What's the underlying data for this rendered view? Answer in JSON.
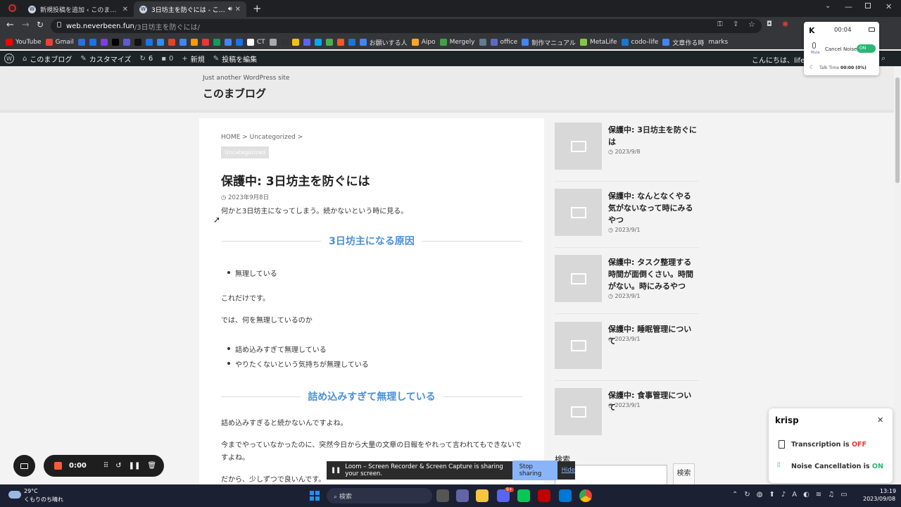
{
  "browser": {
    "tabs": [
      {
        "title": "新規投稿を追加 ‹ このまブログ — WordPress",
        "active": false
      },
      {
        "title": "3日坊主を防ぐには - このまブログ",
        "active": true
      }
    ],
    "new_tab_symbol": "+",
    "url_host": "web.neverbeen.fun",
    "url_path": "/3日坊主を防ぐには/"
  },
  "bookmarks": [
    {
      "label": "YouTube",
      "color": "#ff0000"
    },
    {
      "label": "Gmail",
      "color": "#ea4335"
    },
    {
      "label": "",
      "color": "#2a6fdb",
      "icon": "CW"
    },
    {
      "label": "",
      "color": "#1a73e8",
      "icon": "L"
    },
    {
      "label": "",
      "color": "#7b3fe4"
    },
    {
      "label": "",
      "color": "#000000"
    },
    {
      "label": "",
      "color": "#5b5bd6"
    },
    {
      "label": "",
      "color": "#111111"
    },
    {
      "label": "",
      "color": "#1a73e8"
    },
    {
      "label": "",
      "color": "#2d8cff"
    },
    {
      "label": "",
      "color": "#e24329"
    },
    {
      "label": "",
      "color": "#4285f4"
    },
    {
      "label": "",
      "color": "#ff9900"
    },
    {
      "label": "",
      "color": "#e53935"
    },
    {
      "label": "",
      "color": "#0f9d58"
    },
    {
      "label": "",
      "color": "#4285f4"
    },
    {
      "label": "",
      "color": "#1a73e8"
    },
    {
      "label": "CT",
      "color": "#ffffff"
    },
    {
      "label": "",
      "color": "#aaaaaa"
    },
    {
      "label": "",
      "color": "#333333"
    },
    {
      "label": "",
      "color": "#f4c20d"
    },
    {
      "label": "",
      "color": "#5865f2"
    },
    {
      "label": "",
      "color": "#03a9f4"
    },
    {
      "label": "",
      "color": "#4caf50"
    },
    {
      "label": "",
      "color": "#ff5722"
    },
    {
      "label": "",
      "color": "#1976d2"
    },
    {
      "label": "お願いする人",
      "color": "#4285f4"
    },
    {
      "label": "Aipo",
      "color": "#f9a825"
    },
    {
      "label": "Mergely",
      "color": "#43a047"
    },
    {
      "label": "",
      "color": "#607d8b"
    },
    {
      "label": "office",
      "color": "#5c6bc0"
    },
    {
      "label": "制作マニュアル",
      "color": "#4285f4"
    },
    {
      "label": "MetaLife",
      "color": "#8bc34a"
    },
    {
      "label": "codo-life",
      "color": "#1976d2"
    },
    {
      "label": "文章作る時",
      "color": "#4285f4"
    },
    {
      "label": "marks",
      "color": ""
    }
  ],
  "adminbar": {
    "wp_logo": "W",
    "site_name": "このまブログ",
    "customize": "カスタマイズ",
    "updates_count": "6",
    "comments_count": "0",
    "new": "新規",
    "edit_post": "投稿を編集",
    "greeting": "こんにちは、lifesa"
  },
  "site": {
    "tagline": "Just another WordPress site",
    "title": "このまブログ"
  },
  "article": {
    "breadcrumb": [
      "HOME",
      ">",
      "Uncategorized",
      ">"
    ],
    "category": "Uncategorized",
    "title": "保護中: 3日坊主を防ぐには",
    "date": "2023年9月8日",
    "intro": "何かと3日坊主になってしまう。続かないという時に見る。",
    "h2_1": "3日坊主になる原因",
    "list1": [
      "無理している"
    ],
    "p1": "これだけです。",
    "p2": "では、何を無理しているのか",
    "list2": [
      "詰め込みすぎて無理している",
      "やりたくないという気持ちが無理している"
    ],
    "h2_2": "詰め込みすぎて無理している",
    "p3": "詰め込みすぎると続かないんですよね。",
    "p4": "今までやっていなかったのに、突然今日から大量の文章の日報をやれって言われてもできないですよね。",
    "p5": "だから、少しずつで良いんです。"
  },
  "sidebar": {
    "posts": [
      {
        "title": "保護中: 3日坊主を防ぐには",
        "date": "2023/9/8"
      },
      {
        "title": "保護中: なんとなくやる気がないなって時にみるやつ",
        "date": "2023/9/1"
      },
      {
        "title": "保護中: タスク整理する時間が面倒くさい。時間がない。時にみるやつ",
        "date": "2023/9/1"
      },
      {
        "title": "保護中: 睡眠管理について",
        "date": "2023/9/1"
      },
      {
        "title": "保護中: 食事管理について",
        "date": "2023/9/1"
      }
    ],
    "search_label": "検索",
    "search_button": "検索"
  },
  "krisp_mini": {
    "logo": "K",
    "timer": "00:04",
    "mute": "Mute",
    "cancel_noise": "Cancel Noise",
    "toggle": "ON",
    "talk_time_label": "Talk Time",
    "talk_time": "00:00 (0%)"
  },
  "krisp_card": {
    "logo": "krisp",
    "transcription_prefix": "Transcription is",
    "transcription_state": "OFF",
    "noise_prefix": "Noise Cancellation is",
    "noise_state": "ON",
    "off_color": "#e53935",
    "on_color": "#2bb673"
  },
  "loom": {
    "timer": "0:00",
    "share_message": "Loom – Screen Recorder & Screen Capture is sharing your screen.",
    "stop_sharing": "Stop sharing",
    "hide": "Hide"
  },
  "taskbar": {
    "temperature": "29°C",
    "weather": "くもりのち晴れ",
    "search": "検索",
    "time": "13:19",
    "date": "2023/09/08",
    "discord_badge": "9+"
  }
}
